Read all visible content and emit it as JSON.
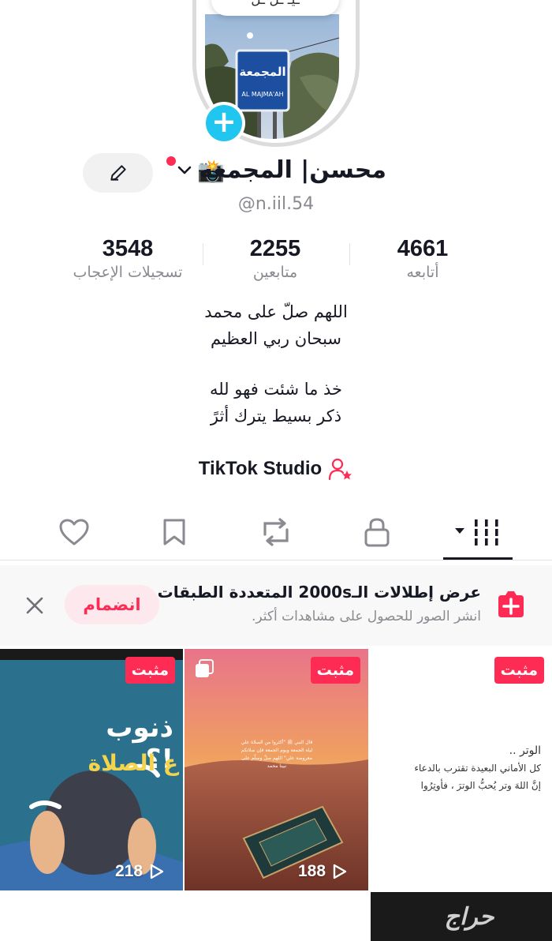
{
  "header": {
    "speech_bubble": "ـيـ ـل ـل",
    "avatar_sign_ar": "المجمعة",
    "avatar_sign_en": "AL MAJMA'AH"
  },
  "profile": {
    "display_name": "محسن| المجمعه",
    "camera_emoji": "📸",
    "username": "@n.iil.54"
  },
  "stats": {
    "following": {
      "value": "4661",
      "label": "أتابعه"
    },
    "followers": {
      "value": "2255",
      "label": "متابعين"
    },
    "likes": {
      "value": "3548",
      "label": "تسجيلات الإعجاب"
    }
  },
  "bio": {
    "lines_1": [
      "اللهم صلّ على محمد",
      "سبحان ربي العظيم"
    ],
    "lines_2": [
      "خذ ما شئت فهو لله",
      "ذكر بسيط يترك أثرً"
    ]
  },
  "studio": {
    "label": "TikTok Studio"
  },
  "tabs": [
    {
      "name": "videos",
      "icon": "grid-icon",
      "active": true
    },
    {
      "name": "private",
      "icon": "lock-icon"
    },
    {
      "name": "reposts",
      "icon": "repost-icon"
    },
    {
      "name": "favorites",
      "icon": "bookmark-icon"
    },
    {
      "name": "liked",
      "icon": "heart-icon"
    }
  ],
  "banner": {
    "title": "عرض إطلالات الـ2000s المتعددة الطبقات",
    "subtitle": "انشر الصور للحصول على مشاهدات أكثر.",
    "join_label": "انضمام"
  },
  "grid": {
    "pinned_label": "مثبت",
    "items": [
      {
        "views": "",
        "pinned": true,
        "text_1": "الوتر ..",
        "text_2": "كل الأماني البعيدة تقترب بالدعاء",
        "text_3": "إنَّ اللهَ وتر يُحبُّ الوترَ ، فأوتِرُوا"
      },
      {
        "views": "188",
        "pinned": true,
        "caption": "قال النبي ﷺ \"أكثروا من الصلاة علي ليلة الجمعة ويوم الجمعة فإن صلاتكم معروضة علي\" اللهم صلّ وسلّم على نبينا محمد"
      },
      {
        "views": "218",
        "pinned": true,
        "headline": "ذنوب !؟",
        "sub": "ع الصلاة"
      }
    ]
  },
  "watermark": "حراج",
  "colors": {
    "accent": "#fe2c55",
    "cyan": "#20c6f0",
    "muted": "#8a8b91"
  }
}
